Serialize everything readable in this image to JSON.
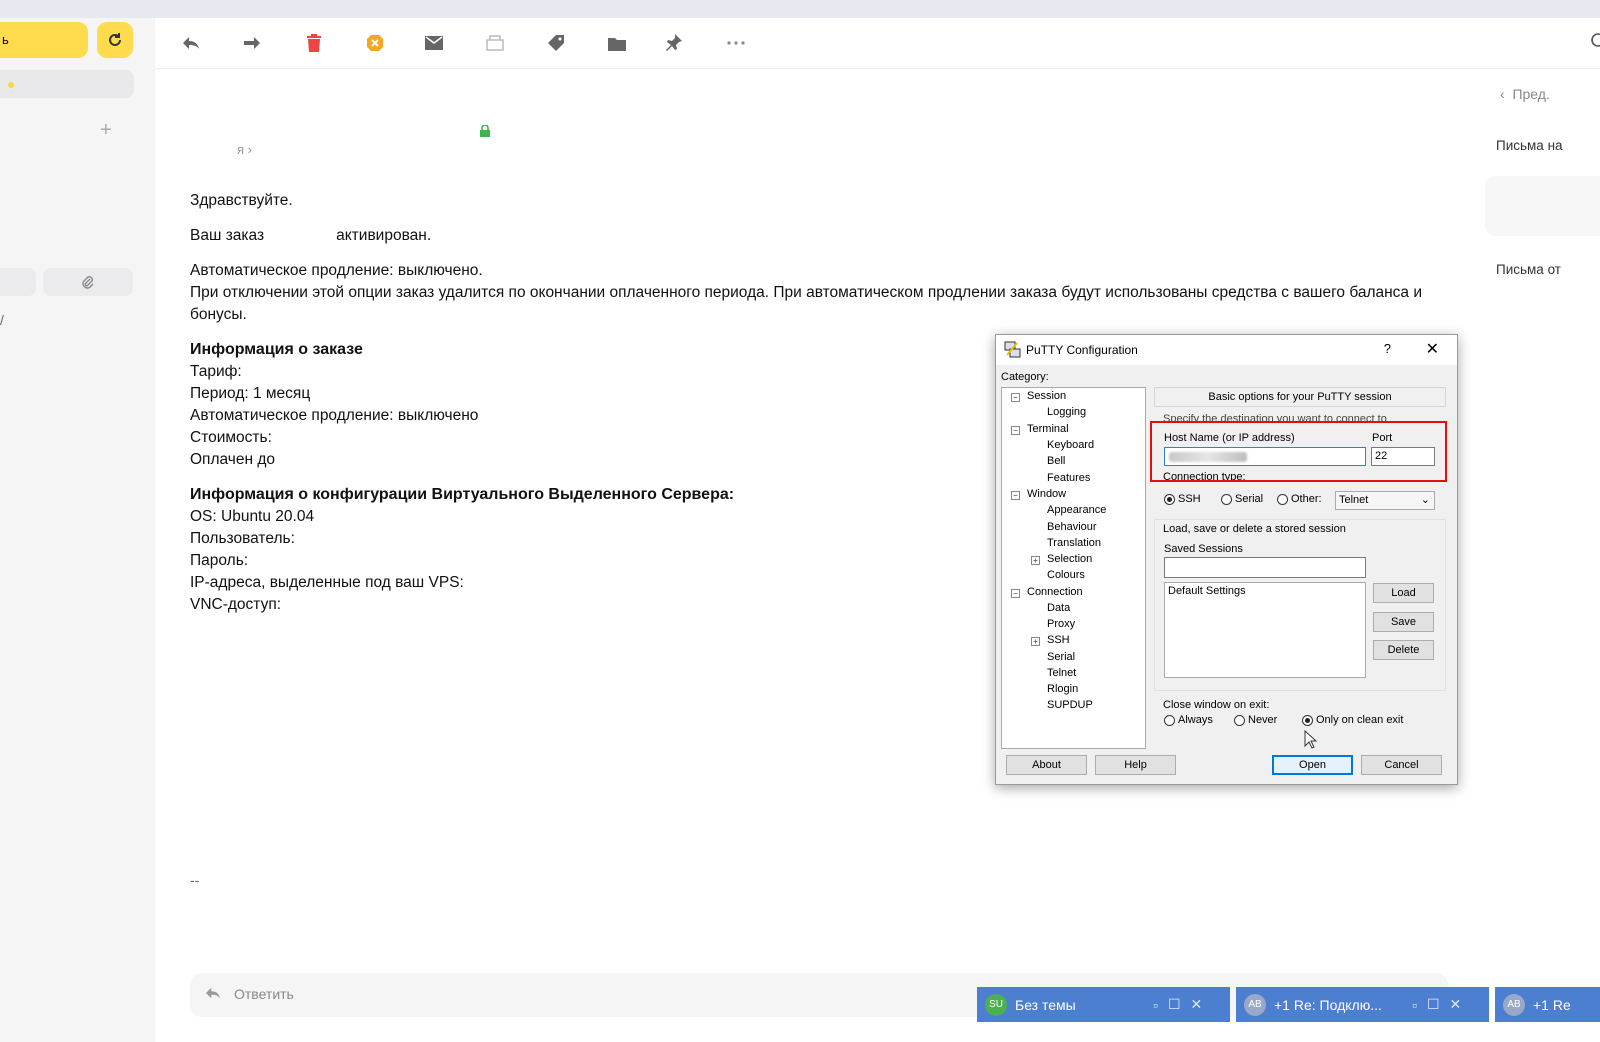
{
  "sidebar": {
    "compose_label": "ь",
    "side_mark": "/"
  },
  "message": {
    "from_label": "я",
    "greeting": "Здравствуйте.",
    "order_prefix": "Ваш заказ",
    "order_suffix": "активирован.",
    "auto_renew": "Автоматическое продление: выключено.",
    "renew_note": "При отключении этой опции заказ удалится по окончании оплаченного периода. При автоматическом продлении заказа будут использованы средства с вашего баланса и бонусы.",
    "order_info_title": "Информация о заказе",
    "order_lines": [
      "Тариф:",
      "Период: 1 месяц",
      "Автоматическое продление: выключено",
      "Стоимость:",
      "Оплачен до"
    ],
    "vps_title": "Информация о конфигурации Виртуального Выделенного Сервера:",
    "vps_lines": [
      "OS: Ubuntu 20.04",
      "Пользователь:",
      "Пароль:",
      "IP-адреса, выделенные под ваш VPS:",
      "VNC-доступ:"
    ],
    "signature": "--"
  },
  "reply": {
    "label": "Ответить"
  },
  "right_panel": {
    "prev": "Пред.",
    "letters_to": "Письма на",
    "letters_from": "Письма от"
  },
  "tabs": [
    {
      "avatar": "SU",
      "label": "Без темы",
      "avatar_color": "#4caf50"
    },
    {
      "avatar": "AB",
      "label": "+1  Re: Подклю...",
      "avatar_color": "#9aa8c8"
    },
    {
      "avatar": "AB",
      "label": "+1  Re",
      "avatar_color": "#9aa8c8"
    }
  ],
  "putty": {
    "title": "PuTTY Configuration",
    "help_q": "?",
    "category_label": "Category:",
    "tree": {
      "session": "Session",
      "logging": "Logging",
      "terminal": "Terminal",
      "keyboard": "Keyboard",
      "bell": "Bell",
      "features": "Features",
      "window": "Window",
      "appearance": "Appearance",
      "behaviour": "Behaviour",
      "translation": "Translation",
      "selection": "Selection",
      "colours": "Colours",
      "connection": "Connection",
      "data": "Data",
      "proxy": "Proxy",
      "ssh": "SSH",
      "serial": "Serial",
      "telnet": "Telnet",
      "rlogin": "Rlogin",
      "supdup": "SUPDUP"
    },
    "basic_options": "Basic options for your PuTTY session",
    "specify_dest": "Specify the destination you want to connect to",
    "host_label": "Host Name (or IP address)",
    "port_label": "Port",
    "port_value": "22",
    "conn_type_label": "Connection type:",
    "radio_ssh": "SSH",
    "radio_serial": "Serial",
    "radio_other": "Other:",
    "other_select": "Telnet",
    "load_save_label": "Load, save or delete a stored session",
    "saved_sessions_label": "Saved Sessions",
    "saved_session_item": "Default Settings",
    "btn_load": "Load",
    "btn_save": "Save",
    "btn_delete": "Delete",
    "close_on_exit_label": "Close window on exit:",
    "radio_always": "Always",
    "radio_never": "Never",
    "radio_clean": "Only on clean exit",
    "btn_about": "About",
    "btn_help": "Help",
    "btn_open": "Open",
    "btn_cancel": "Cancel"
  }
}
